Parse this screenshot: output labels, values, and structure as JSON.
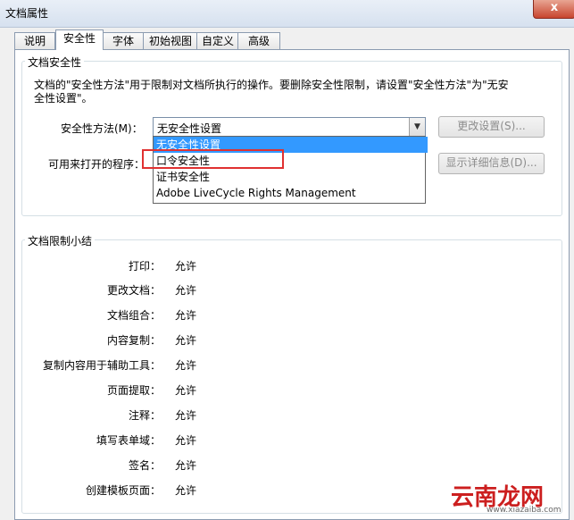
{
  "window": {
    "title": "文档属性",
    "close_label": "x"
  },
  "tabs": [
    {
      "label": "说明"
    },
    {
      "label": "安全性"
    },
    {
      "label": "字体"
    },
    {
      "label": "初始视图"
    },
    {
      "label": "自定义"
    },
    {
      "label": "高级"
    }
  ],
  "security": {
    "group_title": "文档安全性",
    "description": "文档的\"安全性方法\"用于限制对文档所执行的操作。要删除安全性限制，请设置\"安全性方法\"为\"无安全性设置\"。",
    "method_label": "安全性方法(M)：",
    "method_value": "无安全性设置",
    "open_with_label": "可用来打开的程序：",
    "change_button": "更改设置(S)...",
    "details_button": "显示详细信息(D)...",
    "options": [
      {
        "label": "无安全性设置"
      },
      {
        "label": "口令安全性"
      },
      {
        "label": "证书安全性"
      },
      {
        "label": "Adobe LiveCycle Rights Management"
      }
    ]
  },
  "summary": {
    "group_title": "文档限制小结",
    "rows": [
      {
        "label": "打印：",
        "value": "允许"
      },
      {
        "label": "更改文档：",
        "value": "允许"
      },
      {
        "label": "文档组合：",
        "value": "允许"
      },
      {
        "label": "内容复制：",
        "value": "允许"
      },
      {
        "label": "复制内容用于辅助工具：",
        "value": "允许"
      },
      {
        "label": "页面提取：",
        "value": "允许"
      },
      {
        "label": "注释：",
        "value": "允许"
      },
      {
        "label": "填写表单域：",
        "value": "允许"
      },
      {
        "label": "签名：",
        "value": "允许"
      },
      {
        "label": "创建模板页面：",
        "value": "允许"
      }
    ]
  },
  "watermark": {
    "text": "云南龙网",
    "url": "www.xiazaiba.com"
  }
}
